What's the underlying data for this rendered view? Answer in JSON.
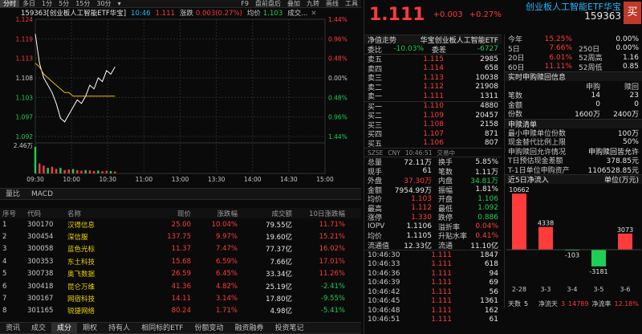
{
  "toolbar": {
    "periods": [
      "分时",
      "多日",
      "1分",
      "5分",
      "15分",
      "30分"
    ],
    "selected_period": "分时",
    "f9": "F9",
    "tools": [
      "盘前盘后",
      "叠加",
      "九转",
      "画线",
      "工具"
    ],
    "collapse_icon": "chevron-down-icon"
  },
  "info": {
    "code_name": "159363[创业板人工智能ETF华宝]",
    "time": "10:46",
    "price": "1.111",
    "change_label": "涨跌",
    "change": "0.003(0.27%)",
    "avg_label": "均价",
    "avg": "1.103",
    "vol_label": "成交...",
    "close_icon": "close-icon"
  },
  "chart_data": {
    "type": "line",
    "x_ticks": [
      "09:30",
      "10:00",
      "10:30",
      "11:00",
      "13:00",
      "13:30",
      "14:00",
      "14:30",
      "15:00"
    ],
    "y_ticks_left": [
      "1.124",
      "1.119",
      "1.113",
      "1.108",
      "1.103",
      "1.097",
      "1.092"
    ],
    "y_ticks_right": [
      "1.44%",
      "0.96%",
      "0.48%",
      "0.00%",
      "0.48%",
      "0.96%",
      "1.44%"
    ],
    "vol_ticks": [
      "2.46万"
    ],
    "prev_close": 1.108,
    "ylim": [
      1.092,
      1.124
    ],
    "series": [
      {
        "values": [
          1.12,
          1.112,
          1.108,
          1.106,
          1.104,
          1.101,
          1.097,
          1.096,
          1.098,
          1.1,
          1.102,
          1.101,
          1.103,
          1.106,
          1.105,
          1.108,
          1.107,
          1.11,
          1.109,
          1.111
        ]
      },
      {
        "values": [
          1.112,
          1.111,
          1.109,
          1.108,
          1.107,
          1.106,
          1.105,
          1.104,
          1.104,
          1.103,
          1.103,
          1.103,
          1.103,
          1.103,
          1.103,
          1.103,
          1.103,
          1.103,
          1.103,
          1.103
        ]
      }
    ],
    "volume": [
      24000,
      9000,
      7000,
      5000,
      6000,
      4000,
      5000,
      3000,
      3500,
      4000,
      3000,
      2500,
      3000,
      2800,
      2200,
      2600,
      2000,
      2400,
      2100,
      1800
    ]
  },
  "chart_tabs": [
    "量比",
    "MACD"
  ],
  "table": {
    "headers": [
      "序号",
      "代码",
      "名称",
      "现价",
      "涨跌幅",
      "成交额",
      "10日涨跌幅"
    ],
    "rows": [
      [
        "1",
        "300170",
        "汉得信息",
        "25.00",
        "10.04%",
        "79.55亿",
        "11.71%"
      ],
      [
        "2",
        "300454",
        "深信服",
        "137.75",
        "9.97%",
        "19.60亿",
        "15.21%"
      ],
      [
        "3",
        "300058",
        "蓝色光标",
        "11.37",
        "7.47%",
        "77.37亿",
        "16.02%"
      ],
      [
        "4",
        "300353",
        "东土科技",
        "15.68",
        "6.59%",
        "7.66亿",
        "17.01%"
      ],
      [
        "5",
        "300738",
        "奥飞数据",
        "26.59",
        "6.45%",
        "33.34亿",
        "11.26%"
      ],
      [
        "6",
        "300418",
        "昆仑万维",
        "41.36",
        "4.82%",
        "25.19亿",
        "-2.41%"
      ],
      [
        "7",
        "300167",
        "网宿科技",
        "14.11",
        "3.14%",
        "17.80亿",
        "-9.55%"
      ],
      [
        "8",
        "301165",
        "锐捷网络",
        "80.24",
        "1.71%",
        "4.98亿",
        "-5.41%"
      ]
    ]
  },
  "bottom_tabs": [
    "资讯",
    "成交",
    "成分",
    "期权",
    "持有人",
    "相同标的ETF",
    "份额变动",
    "融资融券",
    "投资笔记"
  ],
  "bottom_selected": "成分",
  "quote": {
    "price": "1.111",
    "change": "+0.003",
    "change_pct": "+0.27%",
    "name": "创业板人工智能ETF华宝",
    "code": "159363",
    "buy_button": "买",
    "nav_label": "净值走势",
    "nav_name": "华宝创业板人工智能ETF",
    "wei_bi_label": "委比",
    "wei_bi": "-10.03%",
    "wei_cha_label": "委差",
    "wei_cha": "-6727",
    "sells": [
      [
        "卖五",
        "1.115",
        "2985"
      ],
      [
        "卖四",
        "1.114",
        "658"
      ],
      [
        "卖三",
        "1.113",
        "10038"
      ],
      [
        "卖二",
        "1.112",
        "21908"
      ],
      [
        "卖一",
        "1.111",
        "1311"
      ]
    ],
    "buys": [
      [
        "买一",
        "1.110",
        "4880"
      ],
      [
        "买二",
        "1.109",
        "20457"
      ],
      [
        "买三",
        "1.108",
        "2158"
      ],
      [
        "买四",
        "1.107",
        "871"
      ],
      [
        "买五",
        "1.106",
        "807"
      ]
    ],
    "market_line": [
      "SZSE",
      "CNY",
      "10:46:51",
      "交易中"
    ],
    "stats": [
      [
        "总量",
        "72.11万",
        "换手",
        "5.85%"
      ],
      [
        "现手",
        "61",
        "笔数",
        "1.11万"
      ],
      [
        "外盘",
        "37.30万",
        "内盘",
        "34.81万"
      ],
      [
        "金额",
        "7954.99万",
        "振幅",
        "1.81%"
      ],
      [
        "均价",
        "1.103",
        "开盘",
        "1.106"
      ],
      [
        "最高",
        "1.112",
        "最低",
        "1.092"
      ],
      [
        "涨停",
        "1.330",
        "跌停",
        "0.886"
      ],
      [
        "IOPV",
        "1.1106",
        "溢折率",
        "0.04%"
      ],
      [
        "均价",
        "1.1105",
        "升贴水率",
        "0.41%"
      ],
      [
        "流通值",
        "12.33亿",
        "流通",
        "11.10亿"
      ]
    ],
    "ticks": [
      [
        "10:46:30",
        "1.111",
        "1847"
      ],
      [
        "10:46:33",
        "1.111",
        "618"
      ],
      [
        "10:46:36",
        "1.111",
        "94"
      ],
      [
        "10:46:39",
        "1.111",
        "69"
      ],
      [
        "10:46:42",
        "1.111",
        "56"
      ],
      [
        "10:46:45",
        "1.111",
        "1361"
      ],
      [
        "10:46:48",
        "1.111",
        "162"
      ],
      [
        "10:46:51",
        "1.111",
        "61"
      ]
    ]
  },
  "perf": {
    "rows": [
      [
        "今年",
        "15.25%",
        "0.00%"
      ],
      [
        "5日",
        "7.66%",
        "250日",
        "0.00%"
      ],
      [
        "20日",
        "6.01%",
        "52周高",
        "1.16"
      ],
      [
        "60日",
        "11.11%",
        "52周低",
        "0.85"
      ]
    ]
  },
  "creation": {
    "title": "实时申购赎回信息",
    "cols": [
      "申购",
      "赎回"
    ],
    "rows": [
      [
        "笔数",
        "14",
        "23"
      ],
      [
        "金额",
        "0",
        "0"
      ],
      [
        "份数",
        "1600万",
        "2400万"
      ]
    ]
  },
  "margin": {
    "title": "申赎清单",
    "rows": [
      [
        "最小申赎单位份数",
        "100万"
      ],
      [
        "现金替代比例上限",
        "50%"
      ],
      [
        "申购赎回允许情况",
        "申购赎回皆允许"
      ],
      [
        "T日预估现金差额",
        "378.85元"
      ],
      [
        "T-1日单位申购资产",
        "1106528.85元"
      ]
    ]
  },
  "inflow": {
    "title": "近5日净流入",
    "unit": "单位(万元)",
    "dates": [
      "2-28",
      "3-3",
      "3-4",
      "3-5",
      "3-6"
    ],
    "values": [
      10662,
      4338,
      -103,
      -3181,
      3073
    ],
    "footer_label1": "天数",
    "footer_days": "5",
    "footer_label2": "净流天",
    "footer_val2": "3",
    "footer_val3": "14789",
    "footer_label3": "净流率",
    "footer_pct": "12.18%"
  }
}
